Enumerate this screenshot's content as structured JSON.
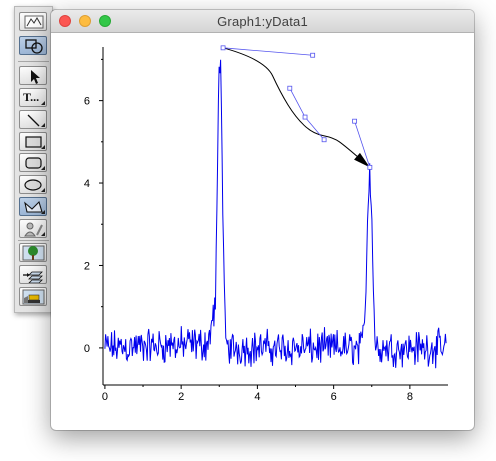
{
  "window": {
    "title": "Graph1:yData1"
  },
  "palette": {
    "tools": [
      {
        "name": "graph-tool",
        "selected": false
      },
      {
        "name": "drawing-layer-tool",
        "selected": true
      },
      {
        "name": "arrow-select-tool",
        "selected": false
      },
      {
        "name": "text-tool",
        "label": "T...",
        "selected": false
      },
      {
        "name": "line-tool",
        "selected": false
      },
      {
        "name": "rectangle-tool",
        "selected": false
      },
      {
        "name": "rounded-rectangle-tool",
        "selected": false
      },
      {
        "name": "oval-tool",
        "selected": false
      },
      {
        "name": "polygon-tool",
        "selected": true
      },
      {
        "name": "user-tool",
        "selected": false
      },
      {
        "name": "layer-tree-tool",
        "selected": false
      },
      {
        "name": "layer-stack-tool",
        "selected": false
      },
      {
        "name": "bulldozer-tool",
        "selected": false
      }
    ]
  },
  "colors": {
    "trace": "#0000ee",
    "polygon": "#000000",
    "handles": "#5555ee"
  },
  "chart_data": {
    "type": "line",
    "title": "",
    "xlabel": "",
    "ylabel": "",
    "xlim": [
      -0.05,
      9
    ],
    "ylim": [
      -0.9,
      7.3
    ],
    "xticks": [
      "0",
      "2",
      "4",
      "6",
      "8"
    ],
    "yticks": [
      "0",
      "2",
      "4",
      "6"
    ],
    "grid": false,
    "series": [
      {
        "baseline": 0,
        "noise_amplitude": 0.35,
        "x": [
          0,
          2.7,
          2.9,
          2.95,
          3.0,
          3.05,
          3.1,
          3.15,
          3.2,
          6.75,
          6.85,
          6.9,
          6.95,
          7.0,
          7.05,
          7.1,
          9.0
        ],
        "y": [
          0,
          0.1,
          1.0,
          4.0,
          7.3,
          6.6,
          2.5,
          0.6,
          0,
          0,
          1.5,
          3.5,
          4.5,
          3.2,
          1.2,
          0,
          0
        ]
      }
    ],
    "drawn_polygon": {
      "points": [
        [
          3.1,
          7.28
        ],
        [
          4.2,
          7.0
        ],
        [
          4.6,
          6.2
        ],
        [
          5.0,
          5.6
        ],
        [
          5.45,
          5.2
        ],
        [
          6.0,
          5.1
        ],
        [
          6.3,
          4.9
        ],
        [
          6.95,
          4.38
        ]
      ],
      "handles": [
        [
          3.1,
          7.28
        ],
        [
          5.45,
          7.1
        ],
        [
          4.85,
          6.3
        ],
        [
          5.25,
          5.6
        ],
        [
          5.75,
          5.05
        ],
        [
          6.55,
          5.5
        ],
        [
          6.95,
          4.38
        ]
      ],
      "arrow_at_end": true
    }
  }
}
